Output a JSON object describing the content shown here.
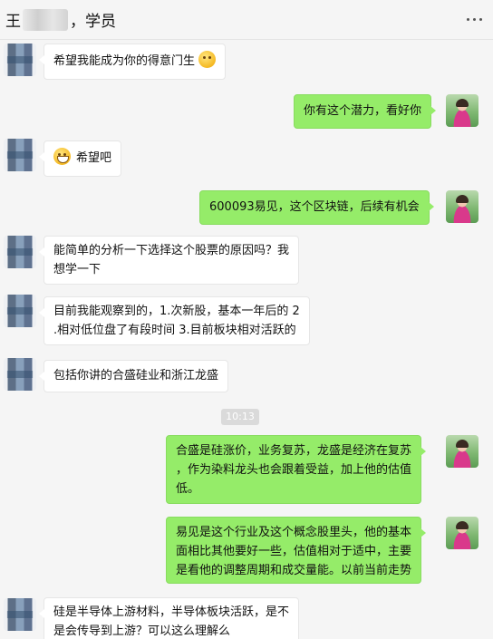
{
  "header": {
    "name_prefix": "王",
    "name_suffix": "，学员"
  },
  "messages": [
    {
      "side": "in",
      "text": "希望我能成为你的得意门生",
      "emoji_after": "thinking-emoji"
    },
    {
      "side": "out",
      "text": "你有这个潜力，看好你"
    },
    {
      "side": "in",
      "text": "希望吧",
      "emoji_before": "grin-emoji"
    },
    {
      "side": "out",
      "text": "600093易见，这个区块链，后续有机会"
    },
    {
      "side": "in",
      "lines": [
        "能简单的分析一下选择这个股票的原因吗？我",
        "想学一下"
      ]
    },
    {
      "side": "in",
      "lines": [
        "目前我能观察到的，1.次新股，基本一年后的 2",
        ".相对低位盘了有段时间 3.目前板块相对活跃的"
      ]
    },
    {
      "side": "in",
      "text": "包括你讲的合盛硅业和浙江龙盛"
    },
    {
      "side": "out",
      "lines": [
        "合盛是硅涨价，业务复苏，龙盛是经济在复苏",
        "，作为染料龙头也会跟着受益，加上他的估值",
        "低。"
      ]
    },
    {
      "side": "out",
      "lines": [
        "易见是这个行业及这个概念股里头，他的基本",
        "面相比其他要好一些，估值相对于适中，主要",
        "是看他的调整周期和成交量能。以前当前走势"
      ]
    },
    {
      "side": "in",
      "lines": [
        "硅是半导体上游材料，半导体板块活跃，是不",
        "是会传导到上游？可以这么理解么"
      ]
    }
  ],
  "timestamp": "10:13",
  "colors": {
    "incoming_bubble": "#ffffff",
    "outgoing_bubble": "#95ec69",
    "background": "#f5f5f5",
    "timestamp_bg": "#dadada"
  }
}
